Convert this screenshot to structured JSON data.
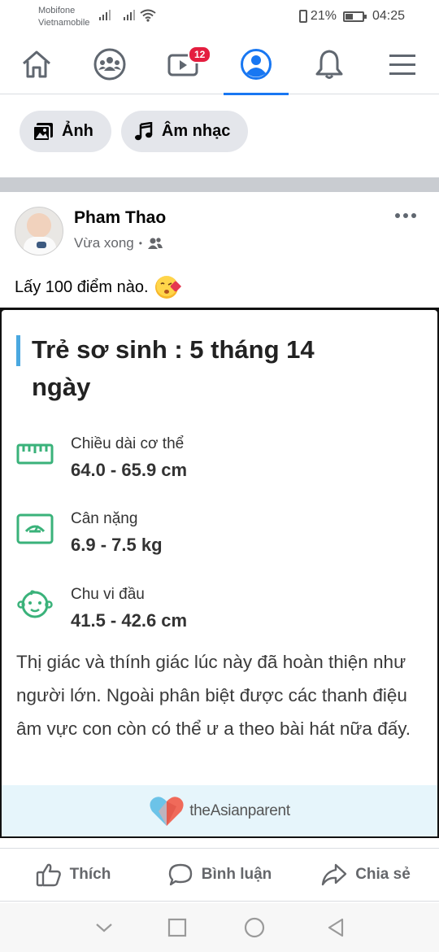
{
  "status_bar": {
    "carrier_1": "Mobifone",
    "carrier_2": "Vietnamobile",
    "battery_text": "21%",
    "battery_level": 0.21,
    "time": "04:25"
  },
  "top_nav": {
    "items": [
      {
        "icon": "home-icon"
      },
      {
        "icon": "groups-icon"
      },
      {
        "icon": "watch-icon",
        "badge": "12"
      },
      {
        "icon": "profile-icon",
        "active": true
      },
      {
        "icon": "bell-icon"
      },
      {
        "icon": "menu-icon"
      }
    ],
    "accent_color": "#1877f2"
  },
  "chips": [
    {
      "label": "Ảnh",
      "icon": "photo-icon"
    },
    {
      "label": "Âm nhạc",
      "icon": "music-icon"
    }
  ],
  "post": {
    "author": "Pham Thao",
    "time": "Vừa xong",
    "separator": "•",
    "audience_icon": "friends-icon",
    "caption": "Lấy 100 điểm nào.",
    "caption_emoji": "kissing-face-icon"
  },
  "card": {
    "title": "Trẻ sơ sinh : 5 tháng 14 ngày",
    "metrics": [
      {
        "label": "Chiều dài cơ thể",
        "value": "64.0 - 65.9 cm",
        "icon": "ruler-icon"
      },
      {
        "label": "Cân nặng",
        "value": "6.9 - 7.5 kg",
        "icon": "scale-icon"
      },
      {
        "label": "Chu vi đầu",
        "value": "41.5 - 42.6 cm",
        "icon": "baby-face-icon"
      }
    ],
    "description": "Thị giác và thính giác lúc này đã hoàn thiện như người lớn. Ngoài phân biệt được các thanh điệu âm vực con còn có thể ư a theo bài hát nữa đấy.",
    "brand": "theAsianparent",
    "accent_color": "#3ab27a"
  },
  "actions": [
    {
      "label": "Thích",
      "icon": "like-icon"
    },
    {
      "label": "Bình luận",
      "icon": "comment-icon"
    },
    {
      "label": "Chia sẻ",
      "icon": "share-icon"
    }
  ],
  "system_nav": {
    "buttons": [
      "collapse-icon",
      "recents-icon",
      "home-circle-icon",
      "back-icon"
    ]
  }
}
